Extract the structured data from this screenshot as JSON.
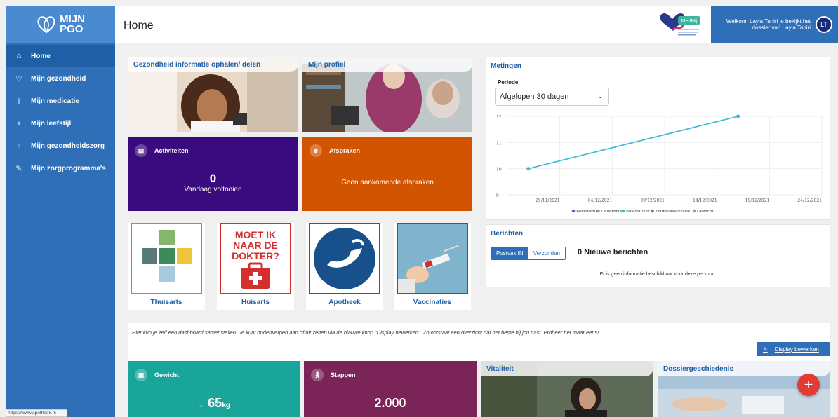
{
  "app": {
    "logo_line1": "MIJN",
    "logo_line2": "PGO",
    "page_title": "Home",
    "welcome": "Welkom, Layla Tahiri je bekijkt het dossier van Layla Tahiri",
    "avatar_initials": "LT",
    "brand_name": "MedMij"
  },
  "sidebar": {
    "items": [
      {
        "label": "Home",
        "icon": "home-icon",
        "active": true
      },
      {
        "label": "Mijn gezondheid",
        "icon": "heart-icon",
        "active": false
      },
      {
        "label": "Mijn medicatie",
        "icon": "pills-icon",
        "active": false
      },
      {
        "label": "Mijn leefstijl",
        "icon": "apple-icon",
        "active": false
      },
      {
        "label": "Mijn gezondheidszorg",
        "icon": "stethoscope-icon",
        "active": false
      },
      {
        "label": "Mijn zorgprogramma's",
        "icon": "program-icon",
        "active": false
      }
    ]
  },
  "tiles": {
    "gezondheid": "Gezondheid informatie ophalen/ delen",
    "profiel": "Mijn profiel",
    "activiteiten": {
      "title": "Activiteiten",
      "count": "0",
      "sub": "Vandaag voltooien",
      "color": "#3a0b7e"
    },
    "afspraken": {
      "title": "Afspraken",
      "sub": "Geen aankomende afspraken",
      "color": "#d35400"
    },
    "links": [
      "Thuisarts",
      "Huisarts",
      "Apotheek",
      "Vaccinaties"
    ],
    "huisarts_img_text": [
      "MOET IK",
      "NAAR DE",
      "DOKTER?"
    ]
  },
  "metingen": {
    "title": "Metingen",
    "periode_label": "Periode",
    "periode_value": "Afgelopen 30 dagen"
  },
  "chart_data": {
    "type": "line",
    "x_ticks": [
      "29/11/2021",
      "04/12/2021",
      "09/12/2021",
      "14/12/2021",
      "19/12/2021",
      "24/12/2021"
    ],
    "y_ticks": [
      9,
      10,
      11,
      12
    ],
    "ylim": [
      9,
      12
    ],
    "xlim": [
      "2021-11-24",
      "2021-12-24"
    ],
    "legend": [
      {
        "name": "Bovendruk",
        "color": "#6a5acd"
      },
      {
        "name": "Onderdruk",
        "color": "#9a8fd8"
      },
      {
        "name": "Bloedsuiker",
        "color": "#3bbcd9"
      },
      {
        "name": "Zuurstofsaturatie",
        "color": "#b04bb0"
      },
      {
        "name": "Gewicht",
        "color": "#999999"
      }
    ],
    "series": [
      {
        "name": "Bloedsuiker",
        "color": "#3bbcd9",
        "points": [
          {
            "x": "2021-11-26",
            "y": 10
          },
          {
            "x": "2021-12-16",
            "y": 12
          }
        ]
      }
    ],
    "legend_position": "bottom",
    "grid": true
  },
  "berichten": {
    "title": "Berichten",
    "tab_in": "Postvak IN",
    "tab_out": "Verzonden",
    "count_text": "0 Nieuwe berichten",
    "empty_text": "Er is geen informatie beschikbaar voor deze persoon."
  },
  "info": {
    "text": "Hier kun je zelf een dashboard samenstellen. Je kunt onderwerpen aan of uit zetten via de blauwe knop \"Display bewerken\". Zo ontstaat een overzicht dat het beste bij jou past. Probeer het maar eens!",
    "button": "Display bewerken"
  },
  "bottom": {
    "gewicht": {
      "title": "Gewicht",
      "value": "65",
      "unit": "kg",
      "color": "#1aa59a"
    },
    "stappen": {
      "title": "Stappen",
      "value": "2.000",
      "color": "#7a2458"
    },
    "vitaliteit": "Vitaliteit",
    "dossier": "Dossiergeschiedenis"
  },
  "status_url": "https://www.apotheek.nl"
}
